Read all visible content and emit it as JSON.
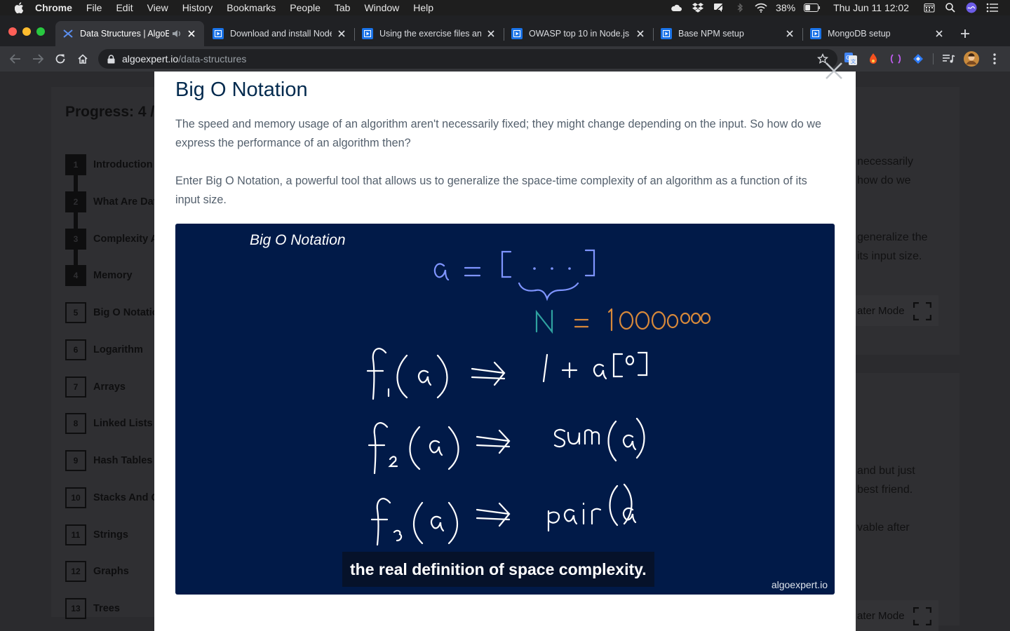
{
  "menubar": {
    "app_name": "Chrome",
    "menus": [
      "File",
      "Edit",
      "View",
      "History",
      "Bookmarks",
      "People",
      "Tab",
      "Window",
      "Help"
    ],
    "battery": "38%",
    "clock": "Thu Jun 11  12:02"
  },
  "tabs": [
    {
      "title": "Data Structures | AlgoExpert"
    },
    {
      "title": "Download and install Node.js"
    },
    {
      "title": "Using the exercise files and"
    },
    {
      "title": "OWASP top 10 in Node.js"
    },
    {
      "title": "Base NPM setup"
    },
    {
      "title": "MongoDB setup"
    }
  ],
  "address": {
    "host": "algoexpert.io",
    "path": "/data-structures"
  },
  "sidebar": {
    "progress": "Progress: 4 /",
    "lessons": [
      {
        "num": "1",
        "name": "Introduction"
      },
      {
        "num": "2",
        "name": "What Are Data Structures?"
      },
      {
        "num": "3",
        "name": "Complexity Analysis"
      },
      {
        "num": "4",
        "name": "Memory"
      },
      {
        "num": "5",
        "name": "Big O Notation"
      },
      {
        "num": "6",
        "name": "Logarithm"
      },
      {
        "num": "7",
        "name": "Arrays"
      },
      {
        "num": "8",
        "name": "Linked Lists"
      },
      {
        "num": "9",
        "name": "Hash Tables"
      },
      {
        "num": "10",
        "name": "Stacks And Queues"
      },
      {
        "num": "11",
        "name": "Strings"
      },
      {
        "num": "12",
        "name": "Graphs"
      },
      {
        "num": "13",
        "name": "Trees"
      }
    ]
  },
  "background_page": {
    "text_lines": [
      "necessarily",
      "how do we",
      "generalize the",
      "its input size.",
      "and but just",
      "best friend.",
      "vable after"
    ],
    "theater_label": "ater Mode"
  },
  "modal": {
    "title": "Big O Notation",
    "paragraph1": "The speed and memory usage of an algorithm aren't necessarily fixed; they might change depending on the input. So how do we express the performance of an algorithm then?",
    "paragraph2": "Enter Big O Notation, a powerful tool that allows us to generalize the space-time complexity of an algorithm as a function of its input size."
  },
  "video": {
    "title": "Big O Notation",
    "caption": "the real definition of space complexity.",
    "watermark": "algoexpert.io"
  }
}
